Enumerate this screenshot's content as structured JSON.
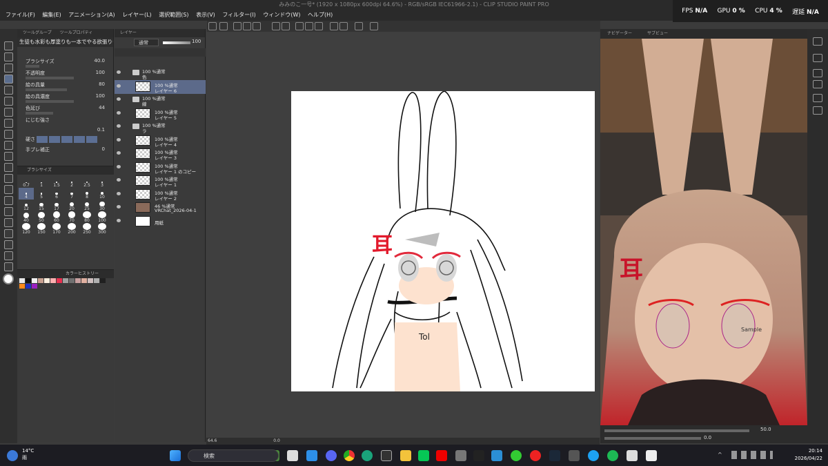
{
  "app": {
    "title": "みみのこ一号* (1920 x 1080px 600dpi 64.6%) - RGB/sRGB IEC61966-2.1) - CLIP STUDIO PAINT PRO"
  },
  "menu": [
    "ファイル(F)",
    "編集(E)",
    "アニメーション(A)",
    "レイヤー(L)",
    "選択範囲(S)",
    "表示(V)",
    "フィルター(I)",
    "ウィンドウ(W)",
    "ヘルプ(H)"
  ],
  "stats": {
    "fps_label": "FPS",
    "fps_value": "N/A",
    "gpu_label": "GPU",
    "gpu_value": "0 %",
    "cpu_label": "CPU",
    "cpu_value": "4 %",
    "latency_label": "遅延",
    "latency_value": "N/A"
  },
  "tool_panel": {
    "tabs": [
      "ツールグループ",
      "ツールプロパティ"
    ],
    "brush_name": "生徒も水彩も厚塗りも一本でやる欲張りものブラシ",
    "props": [
      {
        "label": "ブラシサイズ",
        "value": "40.0"
      },
      {
        "label": "不透明度",
        "value": "100"
      },
      {
        "label": "絵の具量",
        "value": "80"
      },
      {
        "label": "絵の具濃度",
        "value": "100"
      },
      {
        "label": "色延び",
        "value": "44"
      },
      {
        "label": "にじむ強さ",
        "value": ""
      },
      {
        "label": "",
        "value": "0.1"
      },
      {
        "label": "硬さ",
        "value": ""
      },
      {
        "label": "手ブレ補正",
        "value": "0"
      }
    ]
  },
  "brush_size": {
    "title": "ブラシサイズ",
    "sizes": [
      "0.7",
      "1",
      "1.5",
      "2",
      "2.5",
      "3",
      "4",
      "5",
      "6",
      "7",
      "8",
      "10",
      "12",
      "15",
      "17",
      "20",
      "25",
      "30",
      "40",
      "50",
      "60",
      "70",
      "80",
      "100",
      "120",
      "150",
      "170",
      "200",
      "250",
      "300"
    ]
  },
  "color_history": {
    "title": "カラーヒストリー",
    "colors": [
      "#e8e8e8",
      "#111111",
      "#f2f2f2",
      "#c8a090",
      "#fff0e0",
      "#ffb0b0",
      "#e83050",
      "#a0a0a0",
      "#707070",
      "#c8a0a0",
      "#e0b0a0",
      "#d0c0c0",
      "#b0b0b0",
      "#202020",
      "#ff8a1a",
      "#2030c0",
      "#9a20c0"
    ]
  },
  "layers_panel": {
    "tab": "レイヤー",
    "blend_mode": "通常",
    "opacity": "100",
    "layers": [
      {
        "type": "folder",
        "line1": "100 %通常",
        "line2": "色"
      },
      {
        "type": "layer",
        "line1": "100 %通常",
        "line2": "レイヤー 6",
        "selected": true
      },
      {
        "type": "folder",
        "line1": "100 %通常",
        "line2": "線"
      },
      {
        "type": "layer",
        "line1": "100 %通常",
        "line2": "レイヤー 5"
      },
      {
        "type": "folder",
        "line1": "100 %通常",
        "line2": "ラ"
      },
      {
        "type": "layer",
        "line1": "100 %通常",
        "line2": "レイヤー 4"
      },
      {
        "type": "layer",
        "line1": "100 %通常",
        "line2": "レイヤー 3"
      },
      {
        "type": "layer",
        "line1": "100 %通常",
        "line2": "レイヤー 1 のコピー"
      },
      {
        "type": "layer",
        "line1": "100 %通常",
        "line2": "レイヤー 1"
      },
      {
        "type": "layer",
        "line1": "100 %通常",
        "line2": "レイヤー 2"
      },
      {
        "type": "photo",
        "line1": "46 %通常",
        "line2": "VRChat_2026-04-1"
      },
      {
        "type": "paper",
        "line1": "",
        "line2": "用紙"
      }
    ]
  },
  "canvas_status": {
    "zoom": "64.6",
    "angle": "0.0"
  },
  "subview": {
    "tabs": [
      "ナビゲーター",
      "サブビュー"
    ],
    "zoom": "50.0",
    "angle": "0.0",
    "sample_text": "Sample",
    "ear_mark": "耳"
  },
  "canvas_art": {
    "ear_mark": "耳",
    "shirt_text": "Tol"
  },
  "taskbar": {
    "temperature": "14°C",
    "weather": "雨",
    "search_label": "検索",
    "time": "20:14",
    "date": "2026/04/22"
  }
}
